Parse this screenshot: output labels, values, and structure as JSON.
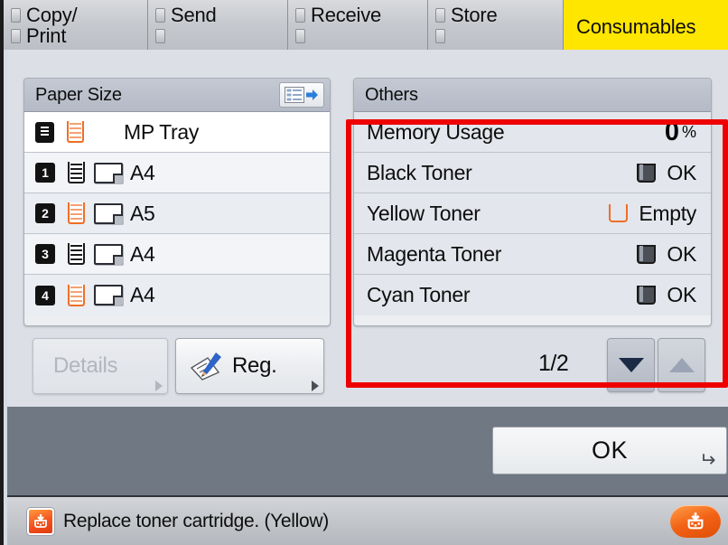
{
  "tabs": [
    {
      "id": "copy-print",
      "label": "Copy/\nPrint",
      "lines": [
        "Copy/",
        "Print"
      ],
      "active": false,
      "icon": "checkbox-icon"
    },
    {
      "id": "send",
      "label": "Send",
      "lines": [
        "Send",
        ""
      ],
      "active": false,
      "icon": "checkbox-icon"
    },
    {
      "id": "receive",
      "label": "Receive",
      "lines": [
        "Receive",
        ""
      ],
      "active": false,
      "icon": "checkbox-icon"
    },
    {
      "id": "store",
      "label": "Store",
      "lines": [
        "Store",
        ""
      ],
      "active": false,
      "icon": "checkbox-icon"
    },
    {
      "id": "consumables",
      "label": "Consumables",
      "active": true
    }
  ],
  "paper_panel": {
    "title": "Paper Size",
    "head_button_icon": "list-export-icon",
    "rows": [
      {
        "source": "MP Tray",
        "tray_badge": "",
        "tray_icon": "mp-tray-icon",
        "level": "low",
        "size": "",
        "label": "MP Tray"
      },
      {
        "source": "Drawer 1",
        "tray_badge": "1",
        "tray_icon": "tray-number-icon",
        "level": "full",
        "size": "A4",
        "label": "A4"
      },
      {
        "source": "Drawer 2",
        "tray_badge": "2",
        "tray_icon": "tray-number-icon",
        "level": "low",
        "size": "A5",
        "label": "A5"
      },
      {
        "source": "Drawer 3",
        "tray_badge": "3",
        "tray_icon": "tray-number-icon",
        "level": "full",
        "size": "A4",
        "label": "A4"
      },
      {
        "source": "Drawer 4",
        "tray_badge": "4",
        "tray_icon": "tray-number-icon",
        "level": "low",
        "size": "A4",
        "label": "A4"
      }
    ]
  },
  "others_panel": {
    "title": "Others",
    "rows": [
      {
        "label": "Memory Usage",
        "value": "0",
        "unit": "%",
        "kind": "meter"
      },
      {
        "label": "Black Toner",
        "status": "OK",
        "kind": "toner",
        "state": "ok"
      },
      {
        "label": "Yellow Toner",
        "status": "Empty",
        "kind": "toner",
        "state": "empty"
      },
      {
        "label": "Magenta Toner",
        "status": "OK",
        "kind": "toner",
        "state": "ok"
      },
      {
        "label": "Cyan Toner",
        "status": "OK",
        "kind": "toner",
        "state": "ok"
      }
    ]
  },
  "actions": {
    "details_label": "Details",
    "details_enabled": false,
    "reg_label": "Reg.",
    "reg_icon": "pencil-note-icon",
    "page_indicator": "1/2",
    "page_down_icon": "triangle-down-icon",
    "page_up_icon": "triangle-up-icon",
    "page_down_enabled": true,
    "page_up_enabled": false
  },
  "footer": {
    "ok_label": "OK",
    "enter_glyph": "↵"
  },
  "status_bar": {
    "message": "Replace toner cartridge. (Yellow)",
    "left_icon": "toner-alert-icon",
    "right_icon": "toner-alert-icon"
  },
  "colors": {
    "active_tab": "#ffe600",
    "alert": "#f26116",
    "annotation": "#ee0000",
    "low_level": "#ef6f26",
    "footer": "#6f7883"
  }
}
